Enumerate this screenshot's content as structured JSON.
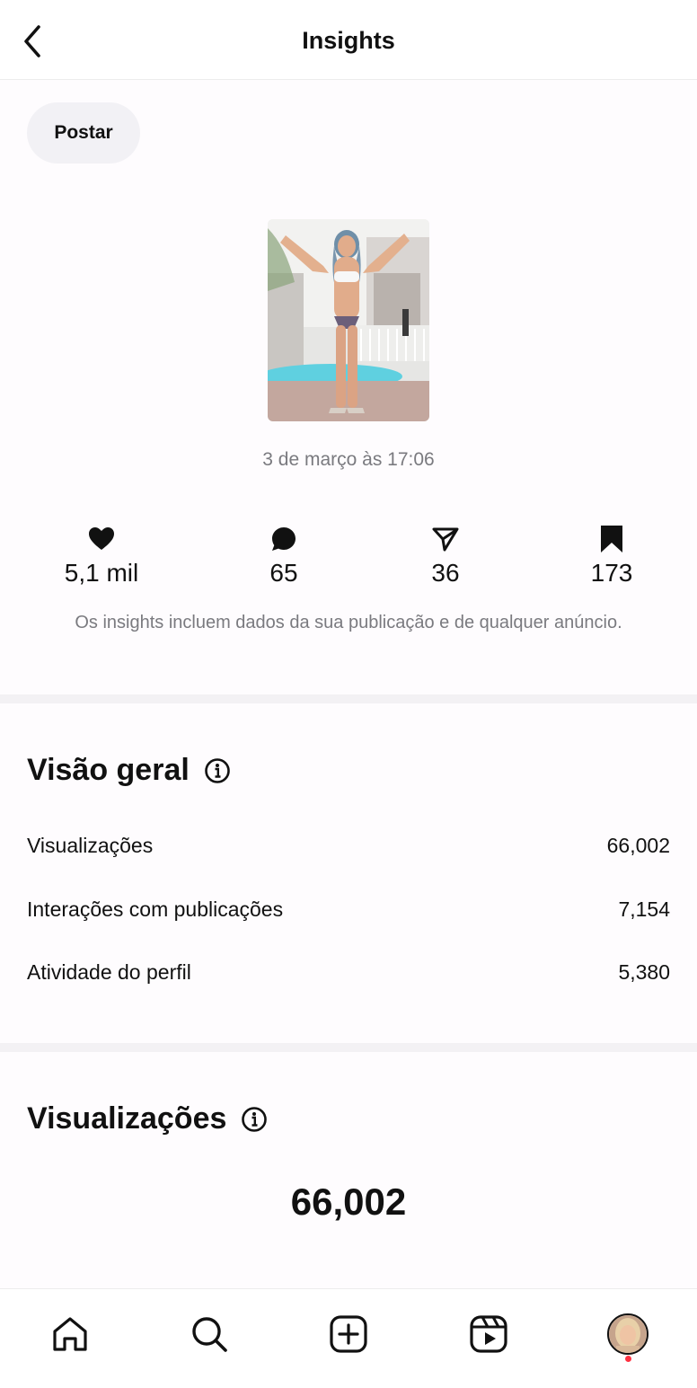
{
  "header": {
    "title": "Insights"
  },
  "filter": {
    "chip_label": "Postar"
  },
  "post": {
    "date": "3 de março às 17:06",
    "stats": [
      {
        "icon": "heart-icon",
        "value": "5,1 mil"
      },
      {
        "icon": "comment-icon",
        "value": "65"
      },
      {
        "icon": "share-icon",
        "value": "36"
      },
      {
        "icon": "bookmark-icon",
        "value": "173"
      }
    ],
    "note": "Os insights incluem dados da sua publicação e de qualquer anúncio."
  },
  "overview": {
    "title": "Visão geral",
    "rows": [
      {
        "label": "Visualizações",
        "value": "66,002"
      },
      {
        "label": "Interações com publicações",
        "value": "7,154"
      },
      {
        "label": "Atividade do perfil",
        "value": "5,380"
      }
    ]
  },
  "views": {
    "title": "Visualizações",
    "total": "66,002"
  },
  "tabbar": {
    "tabs": [
      "home-icon",
      "search-icon",
      "create-icon",
      "reels-icon",
      "profile-avatar"
    ],
    "notification_color": "#ff3040"
  }
}
